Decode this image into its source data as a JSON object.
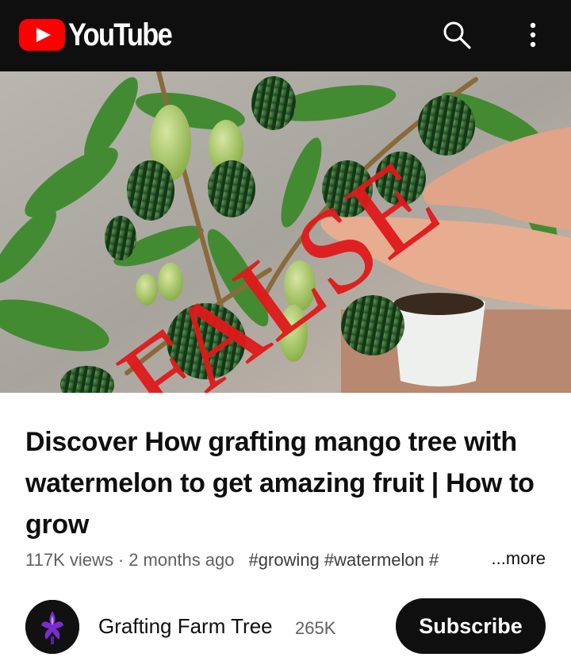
{
  "header": {
    "logo_text": "YouTube",
    "search_icon": "search-icon",
    "menu_icon": "more-vert-icon"
  },
  "thumbnail": {
    "overlay_stamp": "FALSE",
    "stamp_color": "#e0191b"
  },
  "video": {
    "title": "Discover How grafting mango tree with watermelon to get amazing fruit | How to grow",
    "views": "117K views",
    "separator": "·",
    "age": "2 months ago",
    "tags": "#growing #watermelon #",
    "more_label": "...more"
  },
  "channel": {
    "name": "Grafting Farm Tree",
    "subscribers": "265K",
    "subscribe_label": "Subscribe",
    "avatar_icon": "purple-flower-icon"
  },
  "colors": {
    "header_bg": "#0f0f0f",
    "brand_red": "#ff0000",
    "button_bg": "#0f0f0f",
    "secondary_text": "#606060"
  }
}
